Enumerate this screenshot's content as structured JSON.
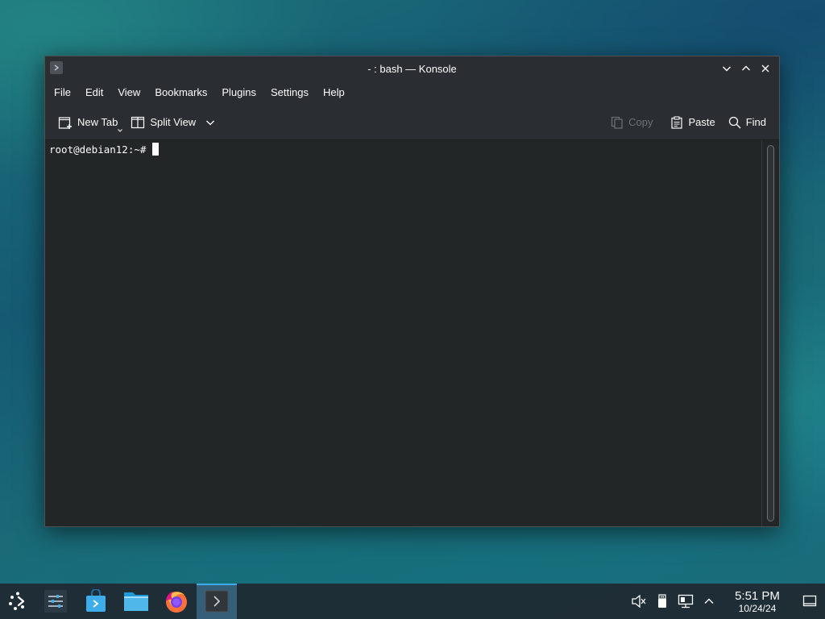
{
  "window": {
    "title": "- : bash — Konsole"
  },
  "menubar": {
    "items": [
      "File",
      "Edit",
      "View",
      "Bookmarks",
      "Plugins",
      "Settings",
      "Help"
    ]
  },
  "toolbar": {
    "new_tab": "New Tab",
    "split_view": "Split View",
    "copy": "Copy",
    "paste": "Paste",
    "find": "Find"
  },
  "terminal": {
    "prompt": "root@debian12:~#"
  },
  "taskbar": {
    "apps": [
      {
        "icon": "application-launcher-icon"
      },
      {
        "icon": "system-settings-icon"
      },
      {
        "icon": "discover-store-icon"
      },
      {
        "icon": "file-manager-icon"
      },
      {
        "icon": "firefox-icon"
      },
      {
        "icon": "konsole-icon",
        "active": true
      }
    ],
    "tray_icons": [
      "volume-muted-icon",
      "usb-device-icon",
      "network-wired-icon",
      "tray-expand-icon"
    ]
  },
  "clock": {
    "time": "5:51 PM",
    "date": "10/24/24"
  },
  "colors": {
    "accent": "#3daee9",
    "window_bg": "#232627",
    "chrome_bg": "#2a2e32"
  }
}
